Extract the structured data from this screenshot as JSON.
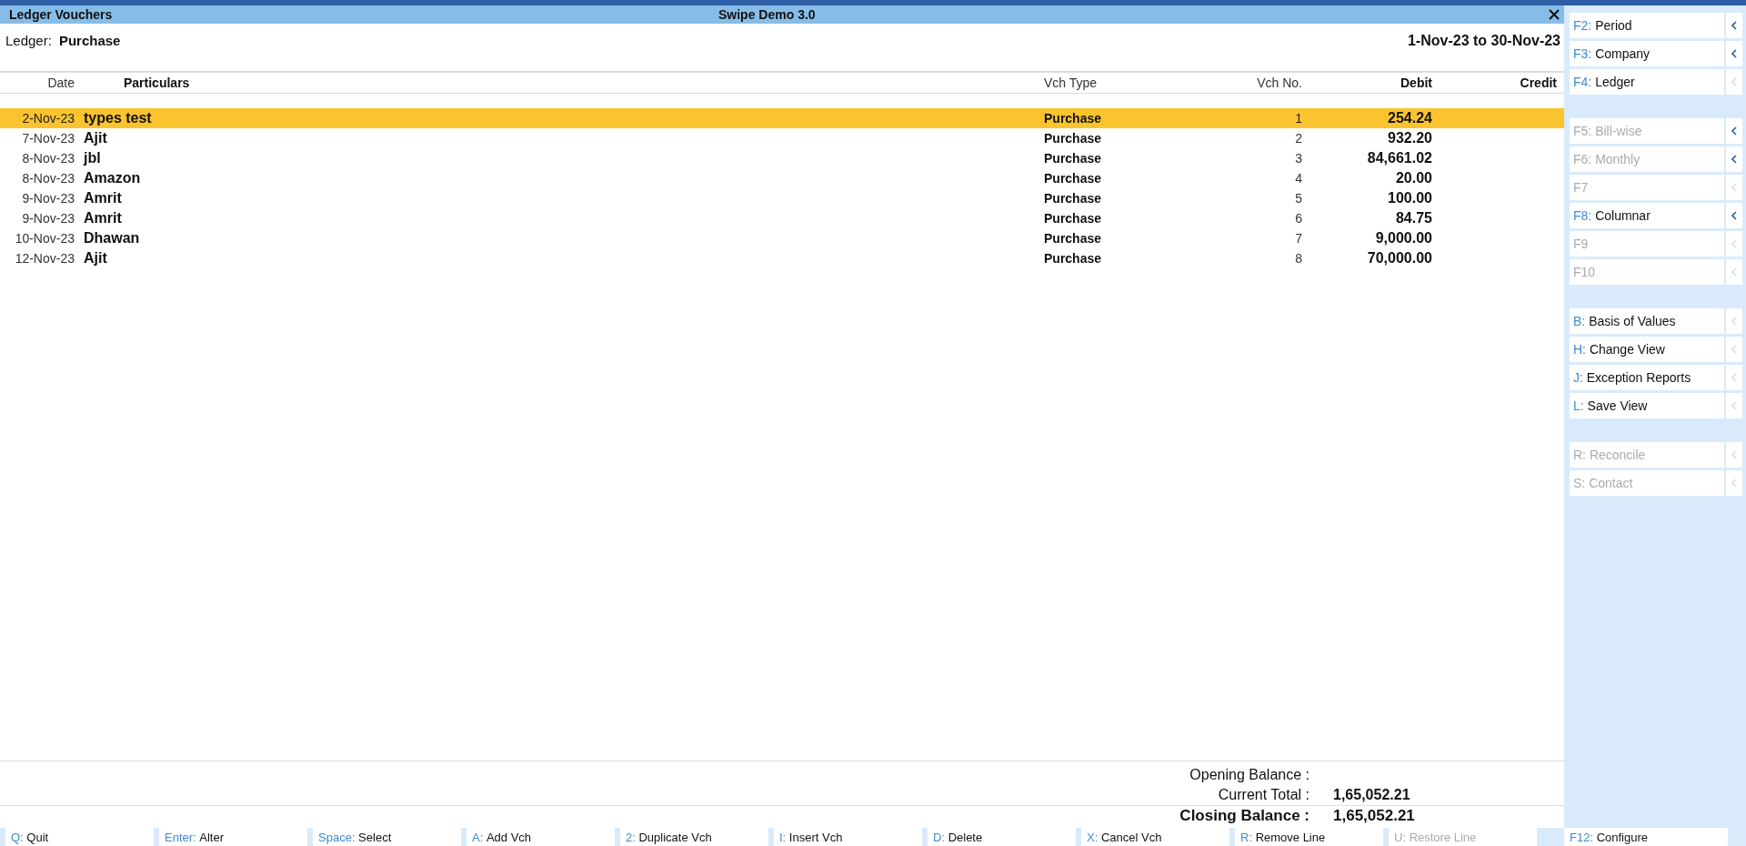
{
  "window": {
    "title": "Ledger Vouchers",
    "company": "Swipe Demo 3.0"
  },
  "ledger": {
    "label": "Ledger:",
    "name": "Purchase",
    "period": "1-Nov-23 to 30-Nov-23"
  },
  "table": {
    "columns": [
      "Date",
      "Particulars",
      "Vch Type",
      "Vch No.",
      "Debit",
      "Credit"
    ],
    "rows": [
      {
        "date": "2-Nov-23",
        "particulars": "types test",
        "vch_type": "Purchase",
        "vch_no": "1",
        "debit": "254.24",
        "selected": true
      },
      {
        "date": "7-Nov-23",
        "particulars": "Ajit",
        "vch_type": "Purchase",
        "vch_no": "2",
        "debit": "932.20",
        "selected": false
      },
      {
        "date": "8-Nov-23",
        "particulars": "jbl",
        "vch_type": "Purchase",
        "vch_no": "3",
        "debit": "84,661.02",
        "selected": false
      },
      {
        "date": "8-Nov-23",
        "particulars": "Amazon",
        "vch_type": "Purchase",
        "vch_no": "4",
        "debit": "20.00",
        "selected": false
      },
      {
        "date": "9-Nov-23",
        "particulars": "Amrit",
        "vch_type": "Purchase",
        "vch_no": "5",
        "debit": "100.00",
        "selected": false
      },
      {
        "date": "9-Nov-23",
        "particulars": "Amrit",
        "vch_type": "Purchase",
        "vch_no": "6",
        "debit": "84.75",
        "selected": false
      },
      {
        "date": "10-Nov-23",
        "particulars": "Dhawan",
        "vch_type": "Purchase",
        "vch_no": "7",
        "debit": "9,000.00",
        "selected": false
      },
      {
        "date": "12-Nov-23",
        "particulars": "Ajit",
        "vch_type": "Purchase",
        "vch_no": "8",
        "debit": "70,000.00",
        "selected": false
      }
    ]
  },
  "totals": [
    {
      "label": "Opening Balance :",
      "bold": false
    },
    {
      "label": "Current Total :",
      "value": "1,65,052.21",
      "bold": false
    },
    {
      "label": "Closing Balance :",
      "value": "1,65,052.21",
      "bold": true
    }
  ],
  "side_panel": [
    [
      {
        "key": "F2:",
        "label": "Period",
        "disabled": false,
        "expandable": true
      },
      {
        "key": "F3:",
        "label": "Company",
        "disabled": false,
        "expandable": true
      },
      {
        "key": "F4:",
        "label": "Ledger",
        "disabled": false,
        "expandable": false
      }
    ],
    [
      {
        "key": "F5:",
        "label": "Bill-wise",
        "disabled": true,
        "expandable": true
      },
      {
        "key": "F6:",
        "label": "Monthly",
        "disabled": true,
        "expandable": true
      },
      {
        "key": "F7",
        "disabled": true,
        "expandable": false
      },
      {
        "key": "F8:",
        "label": "Columnar",
        "disabled": false,
        "expandable": true
      },
      {
        "key": "F9",
        "disabled": true,
        "expandable": false
      },
      {
        "key": "F10",
        "disabled": true,
        "expandable": false
      }
    ],
    [
      {
        "key": "B:",
        "label": "Basis of Values",
        "disabled": false,
        "expandable": false
      },
      {
        "key": "H:",
        "label": "Change View",
        "disabled": false,
        "expandable": false
      },
      {
        "key": "J:",
        "label": "Exception Reports",
        "disabled": false,
        "expandable": false
      },
      {
        "key": "L:",
        "label": "Save View",
        "disabled": false,
        "expandable": false
      }
    ],
    [
      {
        "key": "R:",
        "label": "Reconcile",
        "disabled": true,
        "expandable": false
      },
      {
        "key": "S:",
        "label": "Contact",
        "disabled": true,
        "expandable": false
      }
    ]
  ],
  "button_bar": [
    {
      "key": "Q:",
      "label": "Quit",
      "disabled": false
    },
    {
      "key": "Enter:",
      "label": "Alter",
      "disabled": false
    },
    {
      "key": "Space:",
      "label": "Select",
      "disabled": false
    },
    {
      "key": "A:",
      "label": "Add Vch",
      "disabled": false
    },
    {
      "key": "2:",
      "label": "Duplicate Vch",
      "disabled": false
    },
    {
      "key": "I:",
      "label": "Insert Vch",
      "disabled": false
    },
    {
      "key": "D:",
      "label": "Delete",
      "disabled": false
    },
    {
      "key": "X:",
      "label": "Cancel Vch",
      "disabled": false
    },
    {
      "key": "R:",
      "label": "Remove Line",
      "disabled": false
    },
    {
      "key": "U:",
      "label": "Restore Line",
      "disabled": true
    }
  ],
  "configure_button": {
    "key": "F12:",
    "label": "Configure",
    "disabled": false
  }
}
